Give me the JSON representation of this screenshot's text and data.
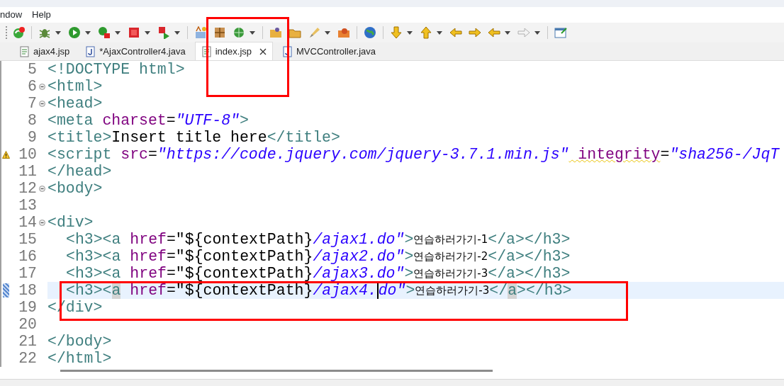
{
  "menu": [
    {
      "label": "ndow"
    },
    {
      "label": "Help"
    }
  ],
  "tabs": [
    {
      "label": "ajax4.jsp",
      "kind": "jsp",
      "selected": false,
      "closable": false
    },
    {
      "label": "*AjaxController4.java",
      "kind": "java",
      "selected": false,
      "closable": false
    },
    {
      "label": "index.jsp",
      "kind": "jsp",
      "selected": true,
      "closable": true
    },
    {
      "label": "MVCController.java",
      "kind": "java",
      "selected": false,
      "closable": false
    }
  ],
  "editor": {
    "lines": [
      {
        "number": "5",
        "fold": false,
        "warning": false,
        "current": false,
        "indented": false,
        "tokens": [
          {
            "kind": "tag",
            "text": "<!DOCTYPE html>"
          }
        ]
      },
      {
        "number": "6",
        "fold": true,
        "warning": false,
        "current": false,
        "indented": false,
        "tokens": [
          {
            "kind": "tag",
            "text": "<html>"
          }
        ]
      },
      {
        "number": "7",
        "fold": true,
        "warning": false,
        "current": false,
        "indented": false,
        "tokens": [
          {
            "kind": "tag",
            "text": "<head>"
          }
        ]
      },
      {
        "number": "8",
        "fold": false,
        "warning": false,
        "current": false,
        "indented": false,
        "tokens": [
          {
            "kind": "tag",
            "text": "<meta"
          },
          {
            "kind": "attr",
            "text": " charset"
          },
          {
            "kind": "plain",
            "text": "="
          },
          {
            "kind": "string",
            "text": "\"UTF-8\""
          },
          {
            "kind": "tag",
            "text": ">"
          }
        ]
      },
      {
        "number": "9",
        "fold": false,
        "warning": false,
        "current": false,
        "indented": false,
        "tokens": [
          {
            "kind": "tag",
            "text": "<title>"
          },
          {
            "kind": "plain",
            "text": "Insert title here"
          },
          {
            "kind": "tag",
            "text": "</title>"
          }
        ]
      },
      {
        "number": "10",
        "fold": false,
        "warning": true,
        "current": false,
        "indented": false,
        "tokens": [
          {
            "kind": "tag",
            "text": "<script"
          },
          {
            "kind": "attr",
            "text": " src"
          },
          {
            "kind": "plain",
            "text": "="
          },
          {
            "kind": "string",
            "text": "\"https://code.jquery.com/jquery-3.7.1.min.js\""
          },
          {
            "kind": "flagged-attr",
            "text": " integrity"
          },
          {
            "kind": "plain",
            "text": "="
          },
          {
            "kind": "string",
            "text": "\"sha256-/JqT"
          }
        ]
      },
      {
        "number": "11",
        "fold": false,
        "warning": false,
        "current": false,
        "indented": false,
        "tokens": [
          {
            "kind": "tag",
            "text": "</head>"
          }
        ]
      },
      {
        "number": "12",
        "fold": true,
        "warning": false,
        "current": false,
        "indented": false,
        "tokens": [
          {
            "kind": "tag",
            "text": "<body>"
          }
        ]
      },
      {
        "number": "13",
        "fold": false,
        "warning": false,
        "current": false
      },
      {
        "number": "14",
        "fold": true,
        "warning": false,
        "current": false,
        "indented": false,
        "tokens": [
          {
            "kind": "tag",
            "text": "<div>"
          }
        ]
      },
      {
        "number": "15",
        "fold": false,
        "warning": false,
        "current": false,
        "indented": true,
        "tokens": [
          {
            "kind": "tag",
            "text": "<h3><a"
          },
          {
            "kind": "attr",
            "text": " href"
          },
          {
            "kind": "plain",
            "text": "="
          },
          {
            "kind": "plain",
            "text": "\"${contextPath}"
          },
          {
            "kind": "string",
            "text": "/ajax1.do\""
          },
          {
            "kind": "tag",
            "text": ">"
          },
          {
            "kind": "text",
            "text": "연습하러가기-1"
          },
          {
            "kind": "tag",
            "text": "</a></h3>"
          }
        ]
      },
      {
        "number": "16",
        "fold": false,
        "warning": false,
        "current": false,
        "indented": true,
        "tokens": [
          {
            "kind": "tag",
            "text": "<h3><a"
          },
          {
            "kind": "attr",
            "text": " href"
          },
          {
            "kind": "plain",
            "text": "="
          },
          {
            "kind": "plain",
            "text": "\"${contextPath}"
          },
          {
            "kind": "string",
            "text": "/ajax2.do\""
          },
          {
            "kind": "tag",
            "text": ">"
          },
          {
            "kind": "text",
            "text": "연습하러가기-2"
          },
          {
            "kind": "tag",
            "text": "</a></h3>"
          }
        ]
      },
      {
        "number": "17",
        "fold": false,
        "warning": false,
        "current": false,
        "indented": true,
        "tokens": [
          {
            "kind": "tag",
            "text": "<h3><a"
          },
          {
            "kind": "attr",
            "text": " href"
          },
          {
            "kind": "plain",
            "text": "="
          },
          {
            "kind": "plain",
            "text": "\"${contextPath}"
          },
          {
            "kind": "string",
            "text": "/ajax3.do\""
          },
          {
            "kind": "tag",
            "text": ">"
          },
          {
            "kind": "text",
            "text": "연습하러가기-3"
          },
          {
            "kind": "tag",
            "text": "</a></h3>"
          }
        ]
      },
      {
        "number": "18",
        "fold": false,
        "warning": false,
        "current": true,
        "indented": true,
        "tokens": [
          {
            "kind": "tag",
            "text": "<h3><"
          },
          {
            "kind": "matched-tag",
            "text": "a"
          },
          {
            "kind": "attr",
            "text": " href"
          },
          {
            "kind": "plain",
            "text": "="
          },
          {
            "kind": "plain",
            "text": "\"${contextPath}"
          },
          {
            "kind": "string",
            "text": "/ajax4."
          },
          {
            "kind": "caret-string",
            "text": "do\""
          },
          {
            "kind": "tag",
            "text": ">"
          },
          {
            "kind": "text",
            "text": "연습하러가기-3"
          },
          {
            "kind": "tag",
            "text": "</"
          },
          {
            "kind": "matched-tag",
            "text": "a"
          },
          {
            "kind": "tag",
            "text": "></h3>"
          }
        ]
      },
      {
        "number": "19",
        "fold": false,
        "warning": false,
        "current": false,
        "indented": false,
        "tokens": [
          {
            "kind": "tag",
            "text": "</div>"
          }
        ]
      },
      {
        "number": "20",
        "fold": false,
        "warning": false,
        "current": false
      },
      {
        "number": "21",
        "fold": false,
        "warning": false,
        "current": false,
        "indented": false,
        "tokens": [
          {
            "kind": "tag",
            "text": "</body>"
          }
        ]
      },
      {
        "number": "22",
        "fold": false,
        "warning": false,
        "current": false,
        "indented": false,
        "tokens": [
          {
            "kind": "tag",
            "text": "</html>"
          }
        ]
      }
    ]
  }
}
